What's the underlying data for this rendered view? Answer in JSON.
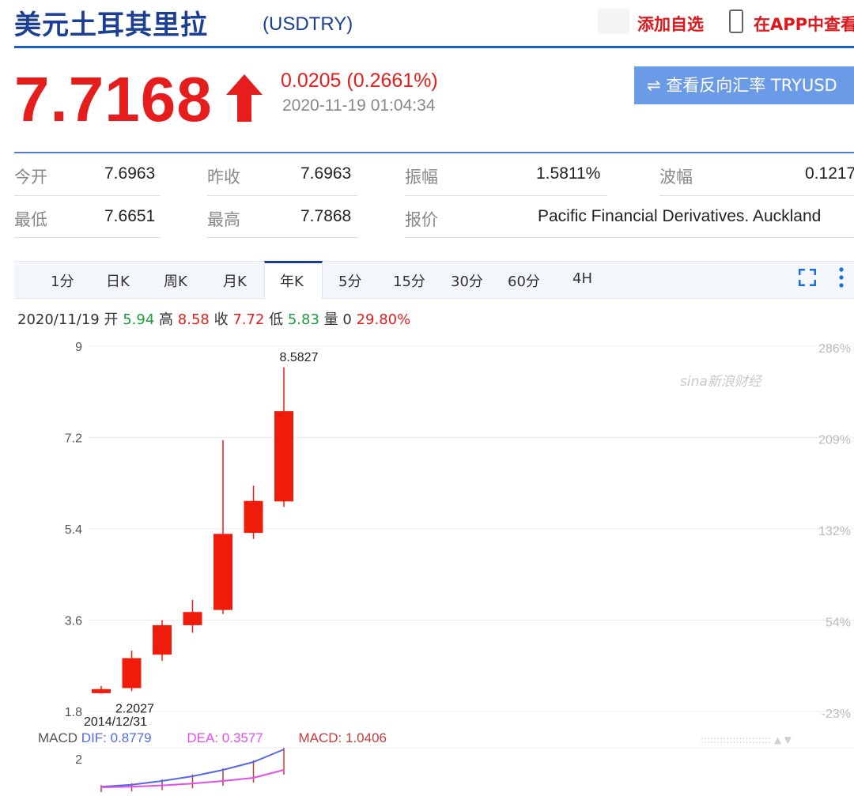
{
  "header": {
    "title": "美元土耳其里拉",
    "code": "(USDTRY)",
    "add_favorite": "添加自选",
    "view_in_app": "在APP中查看"
  },
  "quote": {
    "price": "7.7168",
    "change": "0.0205 (0.2661%)",
    "time": "2020-11-19 01:04:34",
    "reverse_button": "⇌ 查看反向汇率 TRYUSD",
    "colors": {
      "up": "#e61d1d",
      "down": "#1c9c3c",
      "brand": "#1b3f94"
    }
  },
  "stats": {
    "row1": [
      {
        "label": "今开",
        "value": "7.6963"
      },
      {
        "label": "昨收",
        "value": "7.6963"
      },
      {
        "label": "振幅",
        "value": "1.5811%"
      },
      {
        "label": "波幅",
        "value": "0.1217"
      }
    ],
    "row2": [
      {
        "label": "最低",
        "value": "7.6651"
      },
      {
        "label": "最高",
        "value": "7.7868"
      },
      {
        "label": "报价",
        "value": "Pacific Financial Derivatives. Auckland"
      }
    ]
  },
  "tabs": {
    "items": [
      "1分",
      "日K",
      "周K",
      "月K",
      "年K",
      "5分",
      "15分",
      "30分",
      "60分",
      "4H"
    ],
    "active": "年K"
  },
  "ohlc": {
    "date": "2020/11/19",
    "open_label": "开",
    "open": "5.94",
    "high_label": "高",
    "high": "8.58",
    "close_label": "收",
    "close": "7.72",
    "low_label": "低",
    "low": "5.83",
    "volume_label": "量",
    "volume": "0",
    "change_pct": "29.80%"
  },
  "macd": {
    "label": "MACD",
    "dif": "DIF: 0.8779",
    "dea": "DEA: 0.3577",
    "macd": "MACD: 1.0406",
    "axis_label": "2"
  },
  "watermark": "sina新浪财经",
  "chart_data": {
    "type": "candlestick",
    "y_ticks": [
      9,
      7.2,
      5.4,
      3.6,
      1.8
    ],
    "y_tick_labels": [
      "9",
      "7.2",
      "5.4",
      "3.6",
      "1.8"
    ],
    "right_tick_labels": [
      "286%",
      "209%",
      "132%",
      "54%",
      "-23%"
    ],
    "ylim": [
      1.8,
      9
    ],
    "max_label": "8.5827",
    "min_label": "2.2027",
    "start_date_label": "2014/12/31",
    "candles": [
      {
        "open": 2.16,
        "close": 2.24,
        "high": 2.3,
        "low": 2.15
      },
      {
        "open": 2.26,
        "close": 2.85,
        "high": 3.0,
        "low": 2.2
      },
      {
        "open": 2.92,
        "close": 3.5,
        "high": 3.6,
        "low": 2.8
      },
      {
        "open": 3.5,
        "close": 3.76,
        "high": 4.0,
        "low": 3.35
      },
      {
        "open": 3.8,
        "close": 5.3,
        "high": 7.15,
        "low": 3.72
      },
      {
        "open": 5.32,
        "close": 5.95,
        "high": 6.25,
        "low": 5.2
      },
      {
        "open": 5.94,
        "close": 7.72,
        "high": 8.5827,
        "low": 5.83
      }
    ],
    "macd_dif": [
      0.02,
      0.08,
      0.2,
      0.35,
      0.55,
      0.8,
      1.2
    ],
    "macd_dea": [
      0.0,
      0.02,
      0.06,
      0.12,
      0.2,
      0.3,
      0.55
    ]
  }
}
